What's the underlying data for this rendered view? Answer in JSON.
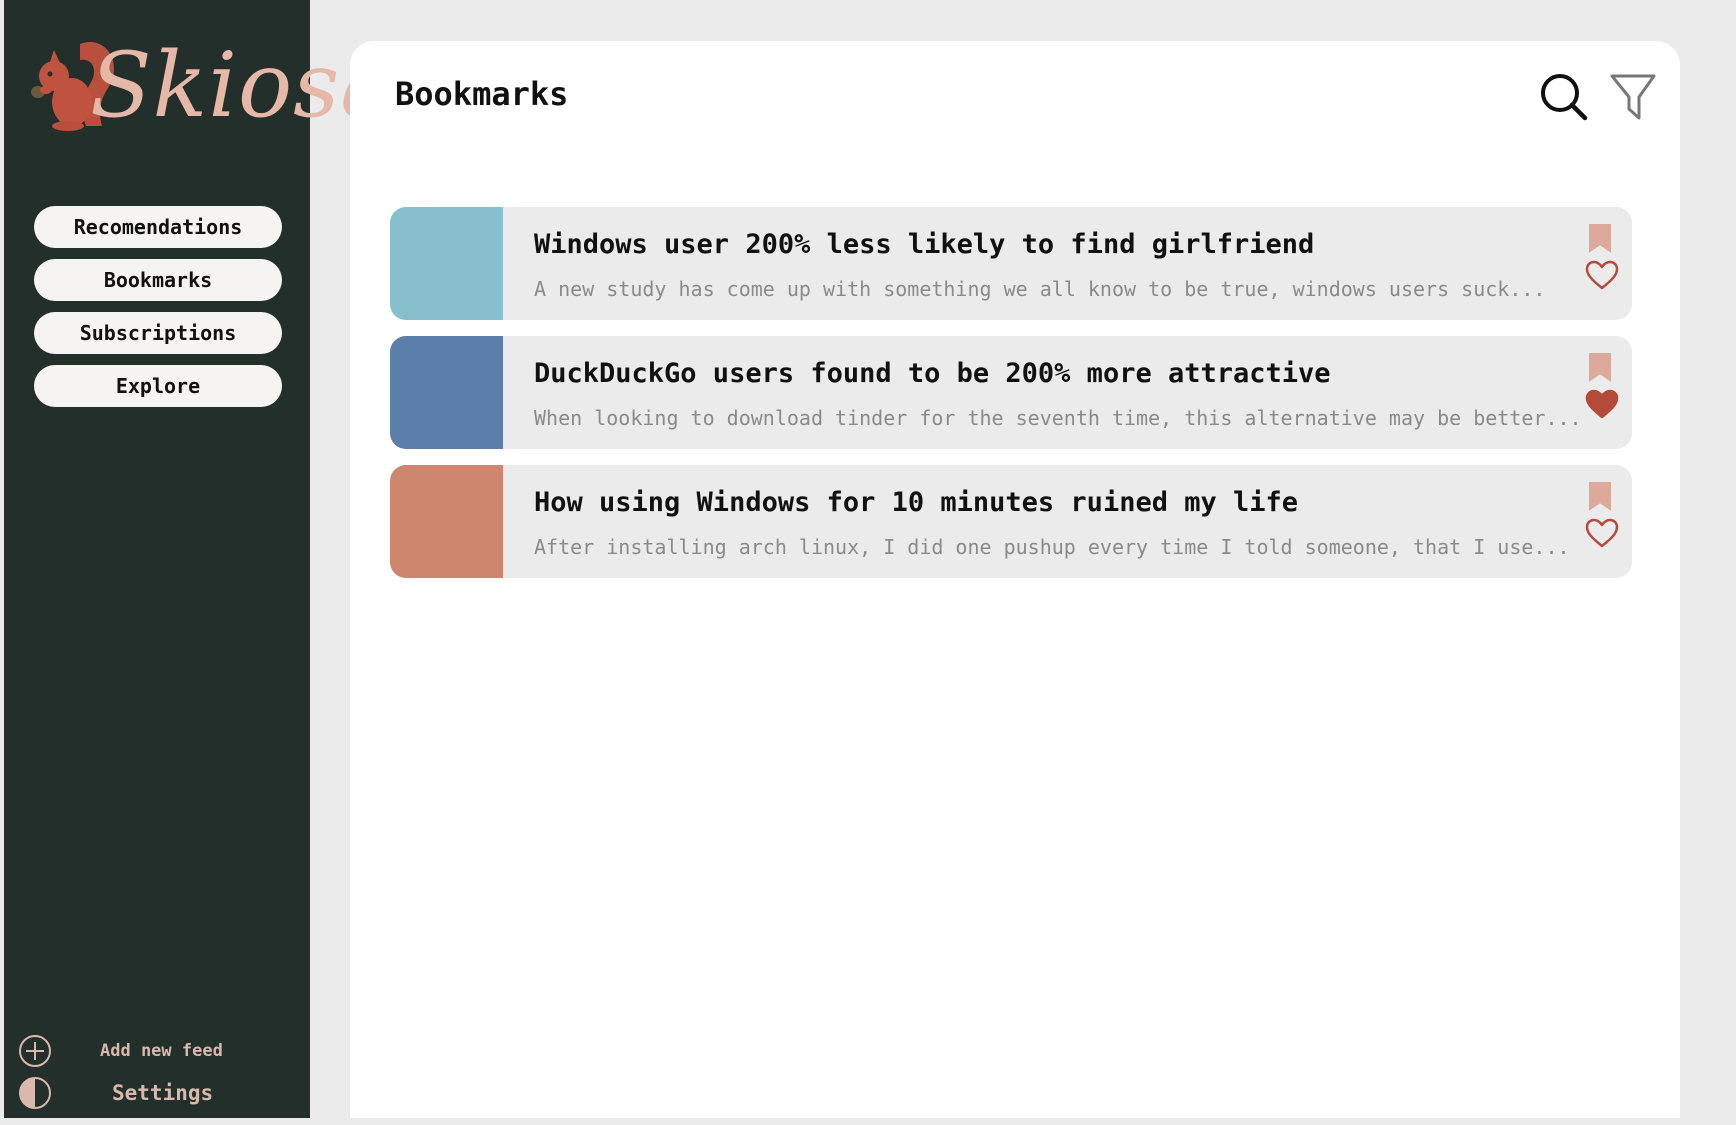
{
  "app": {
    "logo_text": "Skiosa",
    "brand_color": "#c0533f",
    "sidebar_color": "#232f2b",
    "accent_color": "#d9b9ad"
  },
  "sidebar": {
    "items": [
      {
        "label": "Recomendations"
      },
      {
        "label": "Bookmarks"
      },
      {
        "label": "Subscriptions"
      },
      {
        "label": "Explore"
      }
    ],
    "footer": {
      "add_feed_label": "Add new feed",
      "add_feed_icon": "plus-circle-icon",
      "settings_label": "Settings",
      "settings_icon": "half-circle-icon"
    }
  },
  "main": {
    "title": "Bookmarks",
    "tools": [
      {
        "icon": "search-icon"
      },
      {
        "icon": "filter-icon"
      }
    ]
  },
  "articles": [
    {
      "title": "Windows user 200% less likely to find girlfriend",
      "excerpt": "A new study has come up with something we all know to be true, windows users suck...",
      "thumb_color": "#87bfcc",
      "bookmarked": true,
      "liked": false
    },
    {
      "title": "DuckDuckGo users found to be 200% more attractive",
      "excerpt": "When looking to download tinder for the seventh time, this alternative may be better...",
      "thumb_color": "#5b7fa9",
      "bookmarked": true,
      "liked": true
    },
    {
      "title": "How using Windows for 10 minutes ruined my life",
      "excerpt": "After installing arch linux, I did one pushup every time I told someone, that I use...",
      "thumb_color": "#cf866e",
      "bookmarked": true,
      "liked": false
    }
  ]
}
